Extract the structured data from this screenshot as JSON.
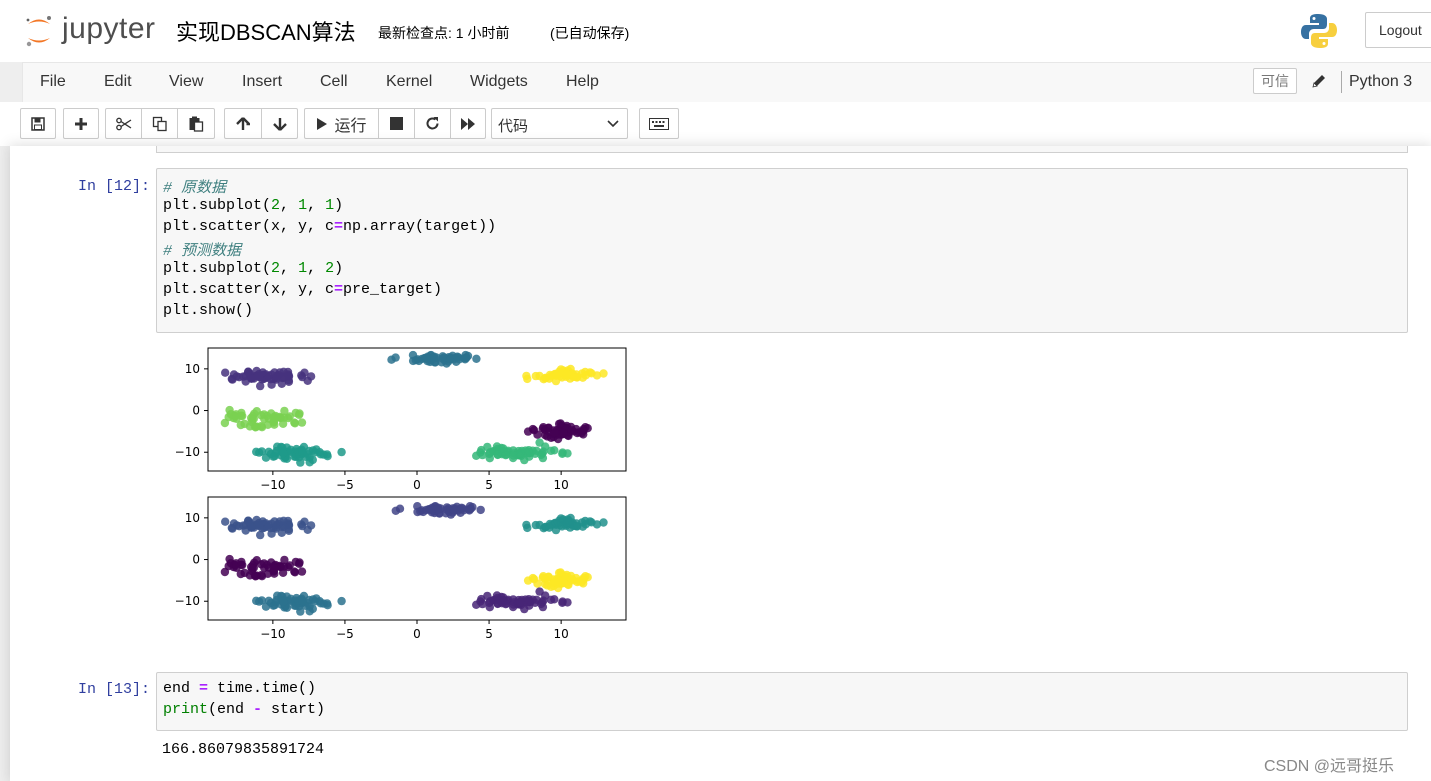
{
  "header": {
    "logo_text": "jupyter",
    "notebook_title": "实现DBSCAN算法",
    "checkpoint": "最新检查点: 1 小时前",
    "autosave": "(已自动保存)",
    "logout_label": "Logout"
  },
  "menubar": {
    "items": [
      "File",
      "Edit",
      "View",
      "Insert",
      "Cell",
      "Kernel",
      "Widgets",
      "Help"
    ],
    "trusted_label": "可信",
    "kernel_name": "Python 3"
  },
  "toolbar": {
    "run_label": "运行",
    "cell_type": "代码"
  },
  "cells": [
    {
      "prompt": "In  [12]:",
      "lines": [
        [
          [
            "cm-comment",
            "# 原数据"
          ]
        ],
        [
          [
            "",
            "plt.subplot("
          ],
          [
            "cm-number",
            "2"
          ],
          [
            "",
            ", "
          ],
          [
            "cm-number",
            "1"
          ],
          [
            "",
            ", "
          ],
          [
            "cm-number",
            "1"
          ],
          [
            "",
            ")"
          ]
        ],
        [
          [
            "",
            "plt.scatter(x, y, c"
          ],
          [
            "cm-operator",
            "="
          ],
          [
            "",
            "np.array(target))"
          ]
        ],
        [
          [
            "cm-comment",
            "# 预测数据"
          ]
        ],
        [
          [
            "",
            "plt.subplot("
          ],
          [
            "cm-number",
            "2"
          ],
          [
            "",
            ", "
          ],
          [
            "cm-number",
            "1"
          ],
          [
            "",
            ", "
          ],
          [
            "cm-number",
            "2"
          ],
          [
            "",
            ")"
          ]
        ],
        [
          [
            "",
            "plt.scatter(x, y, c"
          ],
          [
            "cm-operator",
            "="
          ],
          [
            "",
            "pre_target)"
          ]
        ],
        [
          [
            "",
            "plt.show()"
          ]
        ]
      ]
    },
    {
      "prompt": "In  [13]:",
      "lines": [
        [
          [
            "",
            "end "
          ],
          [
            "cm-operator",
            "="
          ],
          [
            "",
            " time.time()"
          ]
        ],
        [
          [
            "cm-builtin",
            "print"
          ],
          [
            "",
            "(end "
          ],
          [
            "cm-operator",
            "-"
          ],
          [
            "",
            " start)"
          ]
        ]
      ],
      "output": "166.86079835891724"
    }
  ],
  "chart_data": [
    {
      "type": "scatter",
      "xlim": [
        -14.5,
        14.5
      ],
      "ylim": [
        -14.5,
        15
      ],
      "xticks": [
        "−10",
        "−5",
        "0",
        "5",
        "10"
      ],
      "xtick_values": [
        -10,
        -5,
        0,
        5,
        10
      ],
      "yticks": [
        "10",
        "0",
        "−10"
      ],
      "ytick_values": [
        10,
        0,
        -10
      ],
      "clusters": [
        {
          "color": "#46327e",
          "center": [
            -10.5,
            8
          ],
          "spread": [
            1.2,
            0.8
          ],
          "count": 60
        },
        {
          "color": "#7ad151",
          "center": [
            -10.5,
            -2
          ],
          "spread": [
            1.5,
            1.0
          ],
          "count": 55
        },
        {
          "color": "#1f9a8a",
          "center": [
            -8.5,
            -10.5
          ],
          "spread": [
            1.3,
            0.9
          ],
          "count": 60
        },
        {
          "color": "#2c728e",
          "center": [
            1.2,
            12.5
          ],
          "spread": [
            1.5,
            0.6
          ],
          "count": 50
        },
        {
          "color": "#fde725",
          "center": [
            10.5,
            8.5
          ],
          "spread": [
            1.3,
            0.7
          ],
          "count": 50
        },
        {
          "color": "#440154",
          "center": [
            10,
            -5
          ],
          "spread": [
            1.2,
            0.9
          ],
          "count": 55
        },
        {
          "color": "#35b779",
          "center": [
            7,
            -10
          ],
          "spread": [
            1.5,
            0.9
          ],
          "count": 65
        }
      ]
    },
    {
      "type": "scatter",
      "xlim": [
        -14.5,
        14.5
      ],
      "ylim": [
        -14.5,
        15
      ],
      "xticks": [
        "−10",
        "−5",
        "0",
        "5",
        "10"
      ],
      "xtick_values": [
        -10,
        -5,
        0,
        5,
        10
      ],
      "yticks": [
        "10",
        "0",
        "−10"
      ],
      "ytick_values": [
        10,
        0,
        -10
      ],
      "clusters": [
        {
          "color": "#3b528b",
          "center": [
            -10.5,
            8
          ],
          "spread": [
            1.2,
            0.8
          ],
          "count": 60
        },
        {
          "color": "#440154",
          "center": [
            -10.5,
            -2
          ],
          "spread": [
            1.5,
            1.0
          ],
          "count": 55
        },
        {
          "color": "#2c728e",
          "center": [
            -8.5,
            -10.5
          ],
          "spread": [
            1.3,
            0.9
          ],
          "count": 60
        },
        {
          "color": "#414487",
          "center": [
            1.5,
            12
          ],
          "spread": [
            1.5,
            0.6
          ],
          "count": 50
        },
        {
          "color": "#21918c",
          "center": [
            10.5,
            8.5
          ],
          "spread": [
            1.3,
            0.7
          ],
          "count": 50
        },
        {
          "color": "#fde725",
          "center": [
            10,
            -5
          ],
          "spread": [
            1.2,
            0.9
          ],
          "count": 55
        },
        {
          "color": "#482677",
          "center": [
            7,
            -10
          ],
          "spread": [
            1.5,
            0.9
          ],
          "count": 65
        }
      ]
    }
  ],
  "watermark": "CSDN @远哥挺乐"
}
